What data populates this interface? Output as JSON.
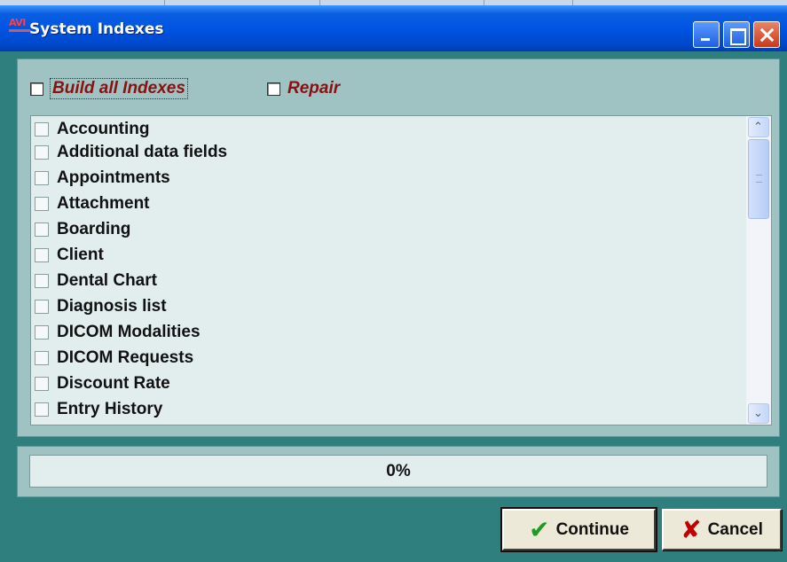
{
  "window": {
    "title": "System Indexes",
    "logo_text": "AVI"
  },
  "options": {
    "build_all_label": "Build all Indexes",
    "repair_label": "Repair"
  },
  "list": {
    "items": [
      {
        "label": "Accounting"
      },
      {
        "label": "Additional data fields"
      },
      {
        "label": "Appointments"
      },
      {
        "label": "Attachment"
      },
      {
        "label": "Boarding"
      },
      {
        "label": "Client"
      },
      {
        "label": "Dental Chart"
      },
      {
        "label": "Diagnosis list"
      },
      {
        "label": "DICOM Modalities"
      },
      {
        "label": "DICOM Requests"
      },
      {
        "label": "Discount Rate"
      },
      {
        "label": "Entry History"
      }
    ]
  },
  "progress": {
    "text": "0%",
    "value": 0
  },
  "buttons": {
    "continue_label": "Continue",
    "cancel_label": "Cancel"
  },
  "colors": {
    "background": "#2f7f7f",
    "panel": "#9fc2c2",
    "list_bg": "#e2eeee",
    "option_label": "#8b1010",
    "titlebar": "#0054e3"
  }
}
